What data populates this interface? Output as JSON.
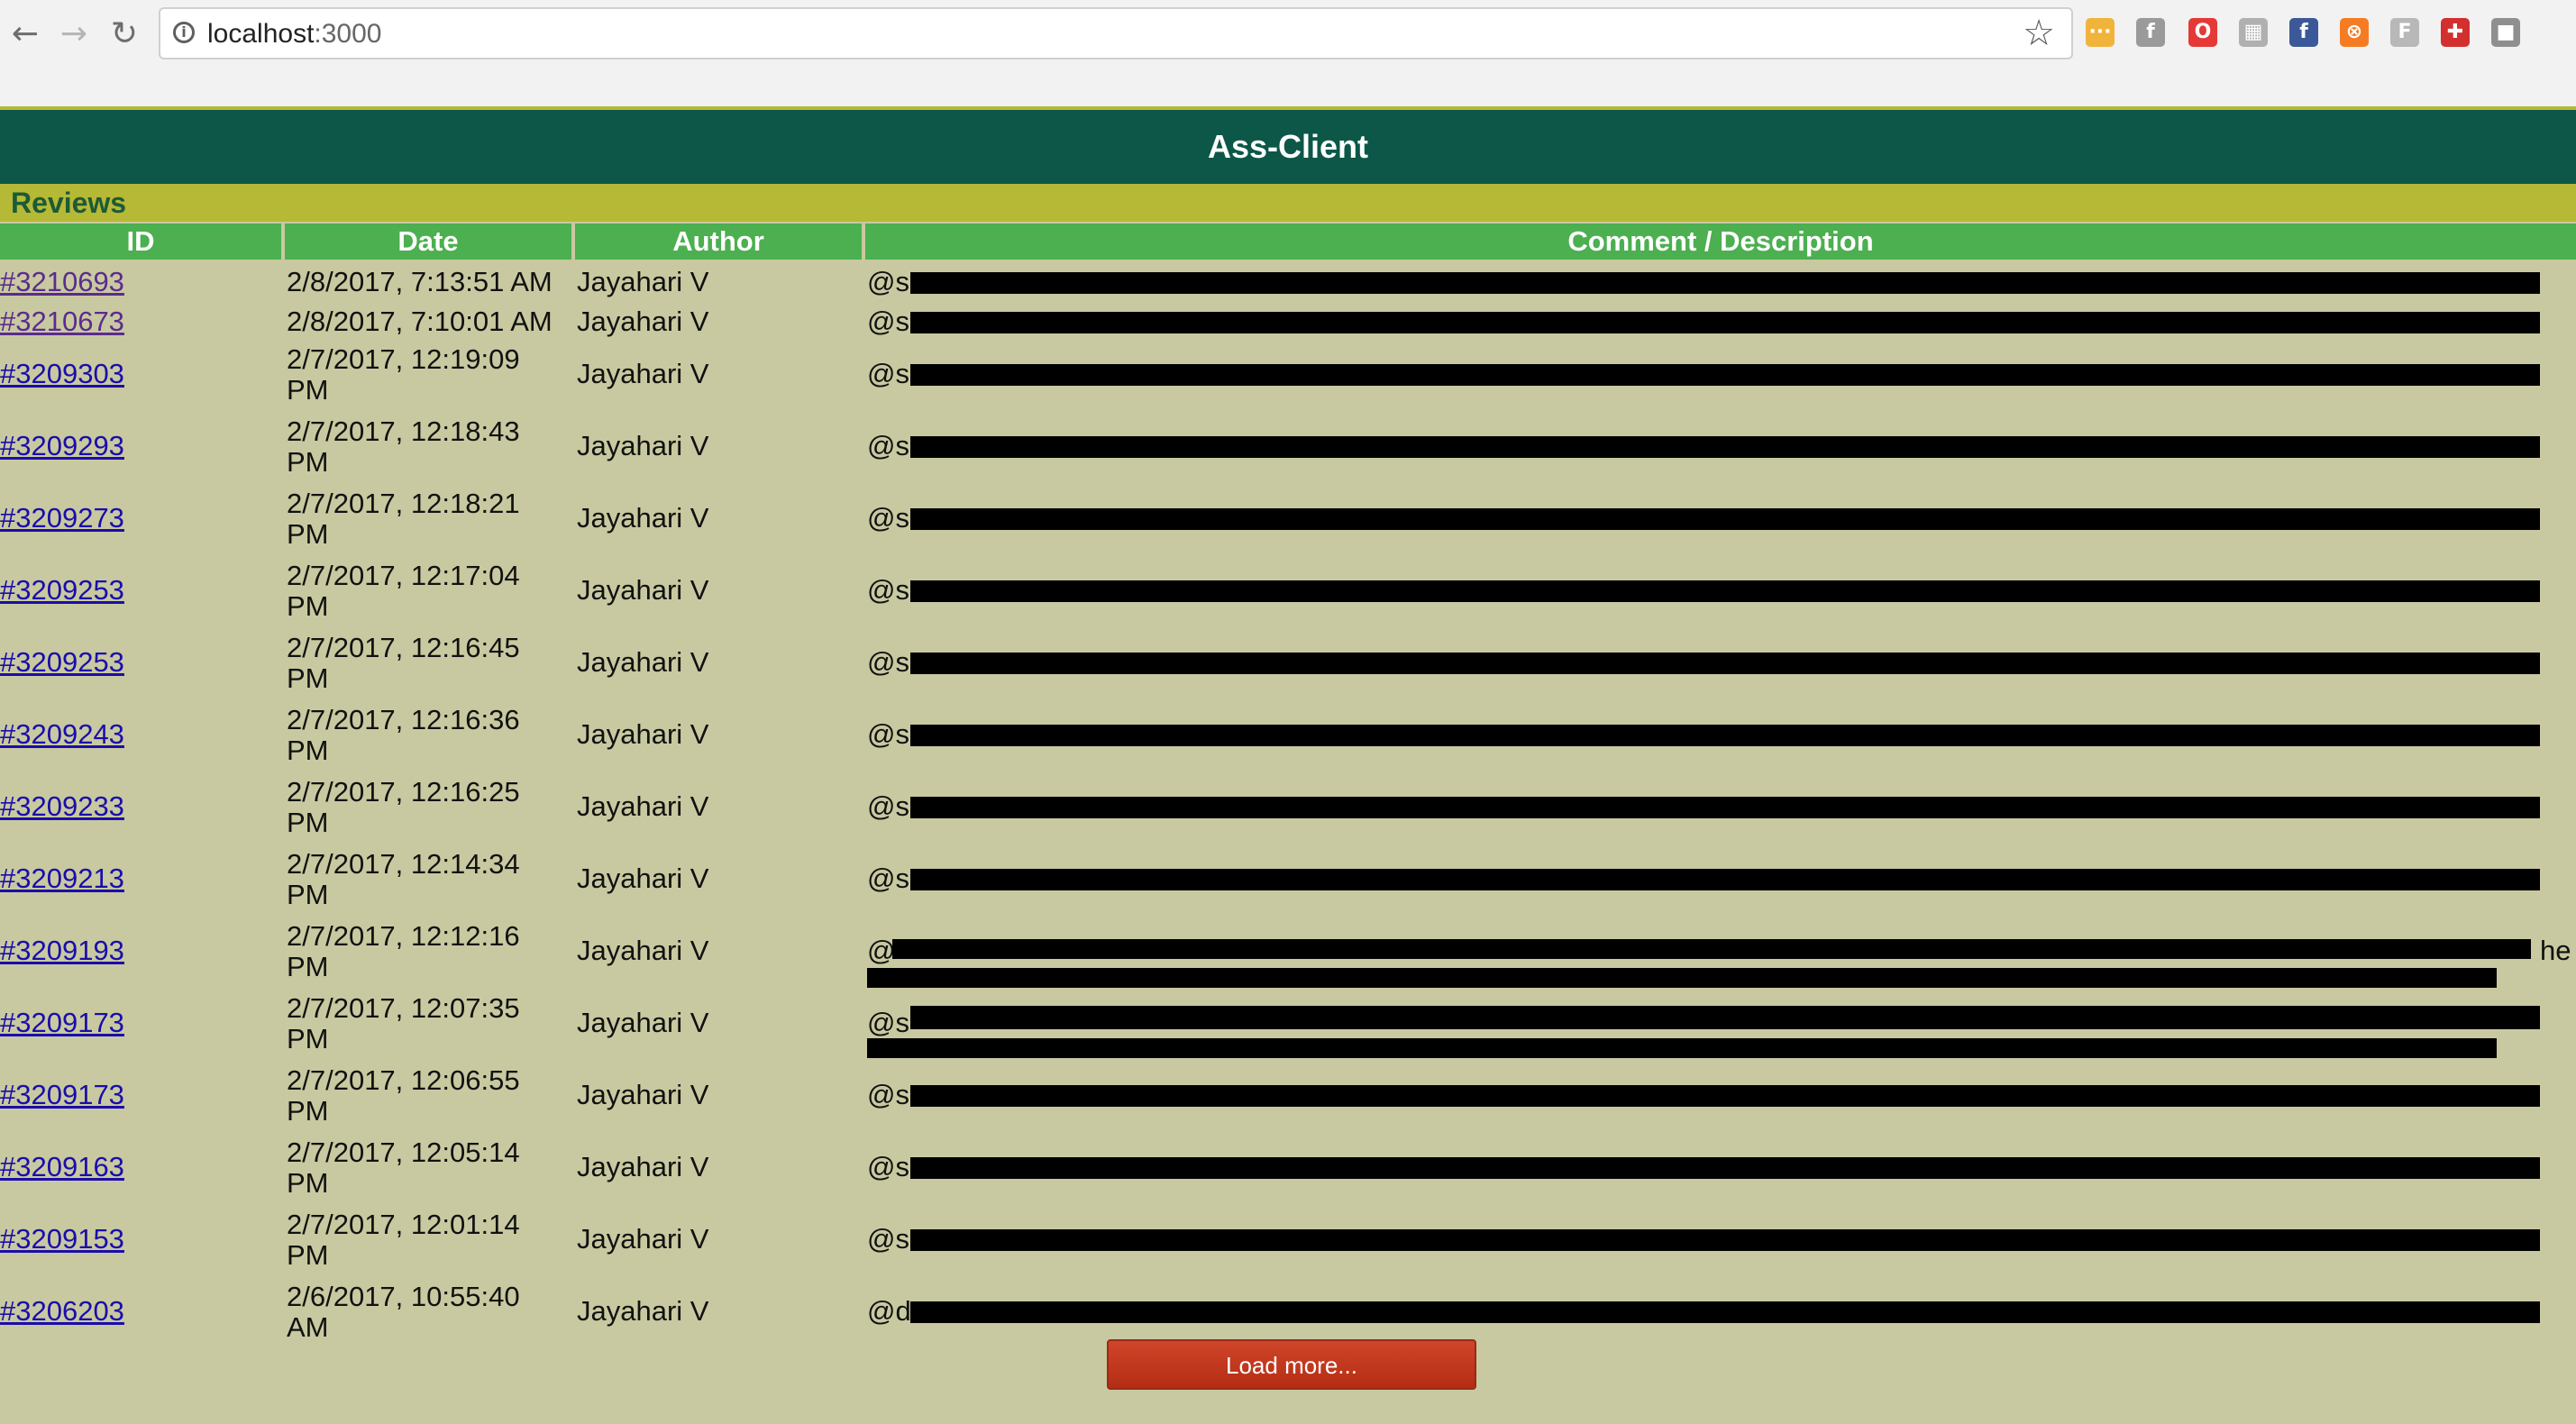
{
  "browser": {
    "url_host": "localhost",
    "url_port": ":3000",
    "extensions": [
      {
        "name": "more-icon",
        "color": "#f0b43c",
        "glyph": "···"
      },
      {
        "name": "facebook-f-icon",
        "color": "#9a9a9a",
        "glyph": "f"
      },
      {
        "name": "opera-icon",
        "color": "#e53935",
        "glyph": "O"
      },
      {
        "name": "grid-icon",
        "color": "#b0b0b0",
        "glyph": "▦"
      },
      {
        "name": "facebook-icon",
        "color": "#3b5998",
        "glyph": "f"
      },
      {
        "name": "orange-circle-icon",
        "color": "#f57c23",
        "glyph": "⊗"
      },
      {
        "name": "f-box-icon",
        "color": "#b8b8b8",
        "glyph": "F"
      },
      {
        "name": "red-cross-icon",
        "color": "#d32f2f",
        "glyph": "✚"
      },
      {
        "name": "gray-box-icon",
        "color": "#8f8f8f",
        "glyph": "■"
      }
    ]
  },
  "app": {
    "title": "Ass-Client"
  },
  "section": {
    "title": "Reviews"
  },
  "table": {
    "headers": [
      "ID",
      "Date",
      "Author",
      "Comment / Description"
    ],
    "rows": [
      {
        "id": "#3210693",
        "date": "2/8/2017, 7:13:51 AM",
        "author": "Jayahari V",
        "comment": "@s",
        "visited": true
      },
      {
        "id": "#3210673",
        "date": "2/8/2017, 7:10:01 AM",
        "author": "Jayahari V",
        "comment": "@s",
        "visited": true
      },
      {
        "id": "#3209303",
        "date": "2/7/2017, 12:19:09 PM",
        "author": "Jayahari V",
        "comment": "@s"
      },
      {
        "id": "#3209293",
        "date": "2/7/2017, 12:18:43 PM",
        "author": "Jayahari V",
        "comment": "@s"
      },
      {
        "id": "#3209273",
        "date": "2/7/2017, 12:18:21 PM",
        "author": "Jayahari V",
        "comment": "@s"
      },
      {
        "id": "#3209253",
        "date": "2/7/2017, 12:17:04 PM",
        "author": "Jayahari V",
        "comment": "@s"
      },
      {
        "id": "#3209253",
        "date": "2/7/2017, 12:16:45 PM",
        "author": "Jayahari V",
        "comment": "@s"
      },
      {
        "id": "#3209243",
        "date": "2/7/2017, 12:16:36 PM",
        "author": "Jayahari V",
        "comment": "@s"
      },
      {
        "id": "#3209233",
        "date": "2/7/2017, 12:16:25 PM",
        "author": "Jayahari V",
        "comment": "@s"
      },
      {
        "id": "#3209213",
        "date": "2/7/2017, 12:14:34 PM",
        "author": "Jayahari V",
        "comment": "@s"
      },
      {
        "id": "#3209193",
        "date": "2/7/2017, 12:12:16 PM",
        "author": "Jayahari V",
        "comment": "@",
        "tail": "he"
      },
      {
        "id": "#3209173",
        "date": "2/7/2017, 12:07:35 PM",
        "author": "Jayahari V",
        "comment": "@s"
      },
      {
        "id": "#3209173",
        "date": "2/7/2017, 12:06:55 PM",
        "author": "Jayahari V",
        "comment": "@s"
      },
      {
        "id": "#3209163",
        "date": "2/7/2017, 12:05:14 PM",
        "author": "Jayahari V",
        "comment": "@s"
      },
      {
        "id": "#3209153",
        "date": "2/7/2017, 12:01:14 PM",
        "author": "Jayahari V",
        "comment": "@s"
      },
      {
        "id": "#3206203",
        "date": "2/6/2017, 10:55:40 AM",
        "author": "Jayahari V",
        "comment": "@d"
      }
    ]
  },
  "load_more_label": "Load more..."
}
